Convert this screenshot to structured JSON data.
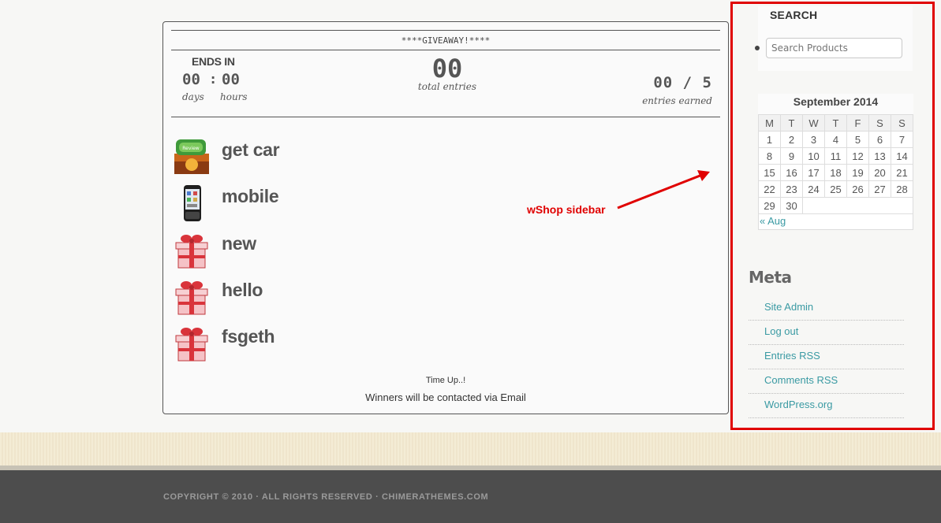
{
  "giveaway": {
    "title": "****GIVEAWAY!****",
    "ends_in_label": "ENDS IN",
    "days_value": "00",
    "separator": ":",
    "hours_value": "00",
    "days_label": "days",
    "hours_label": "hours",
    "total_entries_value": "00",
    "total_entries_label": "total entries",
    "entries_earned_value": "00 / 5",
    "entries_earned_label": "entries earned",
    "entries": [
      {
        "name": "get car",
        "icon": "review-app-icon"
      },
      {
        "name": "mobile",
        "icon": "mobile-phone-icon"
      },
      {
        "name": "new",
        "icon": "gift-box-icon"
      },
      {
        "name": "hello",
        "icon": "gift-box-icon"
      },
      {
        "name": "fsgeth",
        "icon": "gift-box-icon"
      }
    ],
    "time_up": "Time Up..!",
    "winners_note": "Winners will be contacted via Email"
  },
  "annotation": {
    "label": "wShop sidebar",
    "color": "#e00000"
  },
  "sidebar": {
    "search": {
      "heading": "SEARCH",
      "placeholder": "Search Products"
    },
    "calendar": {
      "caption": "September 2014",
      "weekdays": [
        "M",
        "T",
        "W",
        "T",
        "F",
        "S",
        "S"
      ],
      "weeks": [
        [
          "1",
          "2",
          "3",
          "4",
          "5",
          "6",
          "7"
        ],
        [
          "8",
          "9",
          "10",
          "11",
          "12",
          "13",
          "14"
        ],
        [
          "15",
          "16",
          "17",
          "18",
          "19",
          "20",
          "21"
        ],
        [
          "22",
          "23",
          "24",
          "25",
          "26",
          "27",
          "28"
        ],
        [
          "29",
          "30",
          "",
          "",
          "",
          "",
          ""
        ]
      ],
      "prev_link": "« Aug"
    },
    "meta": {
      "heading": "Meta",
      "links": [
        "Site Admin",
        "Log out",
        "Entries RSS",
        "Comments RSS",
        "WordPress.org"
      ]
    },
    "link_color": "#3a9aa3"
  },
  "footer": {
    "copyright": "COPYRIGHT © 2010 · ALL RIGHTS RESERVED · CHIMERATHEMES.COM"
  }
}
